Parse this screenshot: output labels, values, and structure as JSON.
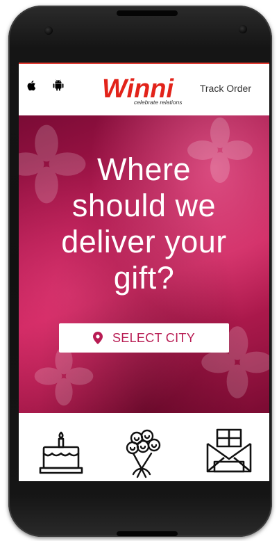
{
  "header": {
    "logo_text": "Winni",
    "logo_tagline": "celebrate relations",
    "track_order_label": "Track Order",
    "icons": [
      "apple-icon",
      "android-icon"
    ]
  },
  "hero": {
    "headline_lines": [
      "Where",
      "should we",
      "deliver your",
      "gift?"
    ],
    "select_city_label": "SELECT CITY",
    "pin_icon": "location-pin-icon"
  },
  "categories": [
    {
      "icon": "birthday-cake-icon"
    },
    {
      "icon": "flower-bouquet-icon"
    },
    {
      "icon": "chocolate-box-icon"
    }
  ],
  "colors": {
    "brand_red": "#e23b32",
    "hero_magenta": "#b0174e",
    "button_text": "#b81c53"
  }
}
